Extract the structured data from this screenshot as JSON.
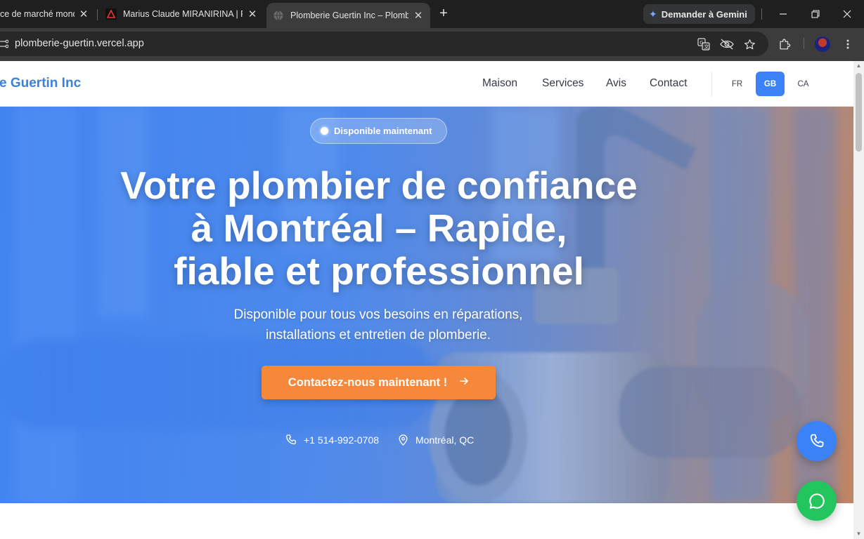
{
  "browser": {
    "tabs": [
      {
        "title": "ce de marché mond",
        "favicon": "globe-icon"
      },
      {
        "title": "Marius Claude MIRANIRINA | Fu",
        "favicon": "triangle-logo-icon"
      },
      {
        "title": "Plomberie Guertin Inc – Plombi",
        "favicon": "globe-icon",
        "active": true
      }
    ],
    "new_tab": "+",
    "gemini_label": "Demander à Gemini",
    "url": "plomberie-guertin.vercel.app"
  },
  "site": {
    "brand": "e Guertin Inc",
    "nav": [
      "Maison",
      "Services",
      "Avis",
      "Contact"
    ],
    "langs": [
      {
        "code": "FR",
        "active": false
      },
      {
        "code": "GB",
        "active": true
      },
      {
        "code": "CA",
        "active": false
      }
    ]
  },
  "hero": {
    "badge": "Disponible maintenant",
    "title_lines": [
      "Votre plombier de confiance",
      "à Montréal – Rapide,",
      "fiable et professionnel"
    ],
    "subtitle_lines": [
      "Disponible pour tous vos besoins en réparations,",
      "installations et entretien de plomberie."
    ],
    "cta": "Contactez-nous maintenant !",
    "phone": "+1 514-992-0708",
    "location": "Montréal, QC"
  },
  "colors": {
    "accent": "#3b82f6",
    "cta": "#f5883a",
    "whatsapp": "#22c55e"
  }
}
